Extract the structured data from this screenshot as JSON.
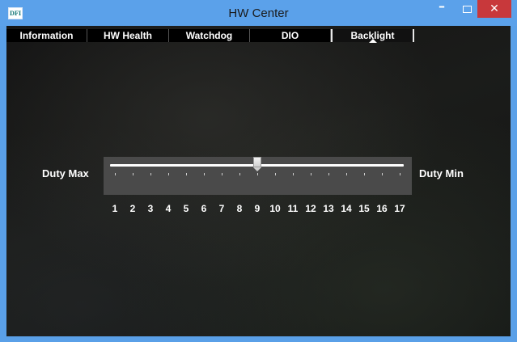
{
  "window": {
    "title": "HW Center",
    "icon_text": "DFI",
    "minimize_glyph": "–",
    "close_glyph": "✕"
  },
  "tabs": [
    {
      "label": "Information",
      "active": false
    },
    {
      "label": "HW Health",
      "active": false
    },
    {
      "label": "Watchdog",
      "active": false
    },
    {
      "label": "DIO",
      "active": false
    },
    {
      "label": "Backlight",
      "active": true
    }
  ],
  "backlight": {
    "left_label": "Duty Max",
    "right_label": "Duty Min",
    "slider": {
      "min": 1,
      "max": 17,
      "value": 9,
      "tick_labels": [
        "1",
        "2",
        "3",
        "4",
        "5",
        "6",
        "7",
        "8",
        "9",
        "10",
        "11",
        "12",
        "13",
        "14",
        "15",
        "16",
        "17"
      ]
    }
  },
  "colors": {
    "titlebar": "#5ba1ea",
    "close_button": "#c8383b",
    "content_background": "#161716",
    "slider_panel": "#4a4a4a"
  },
  "icons": {
    "app": "dfi-logo-icon",
    "minimize": "minimize-icon",
    "maximize": "maximize-icon",
    "close": "close-icon"
  }
}
